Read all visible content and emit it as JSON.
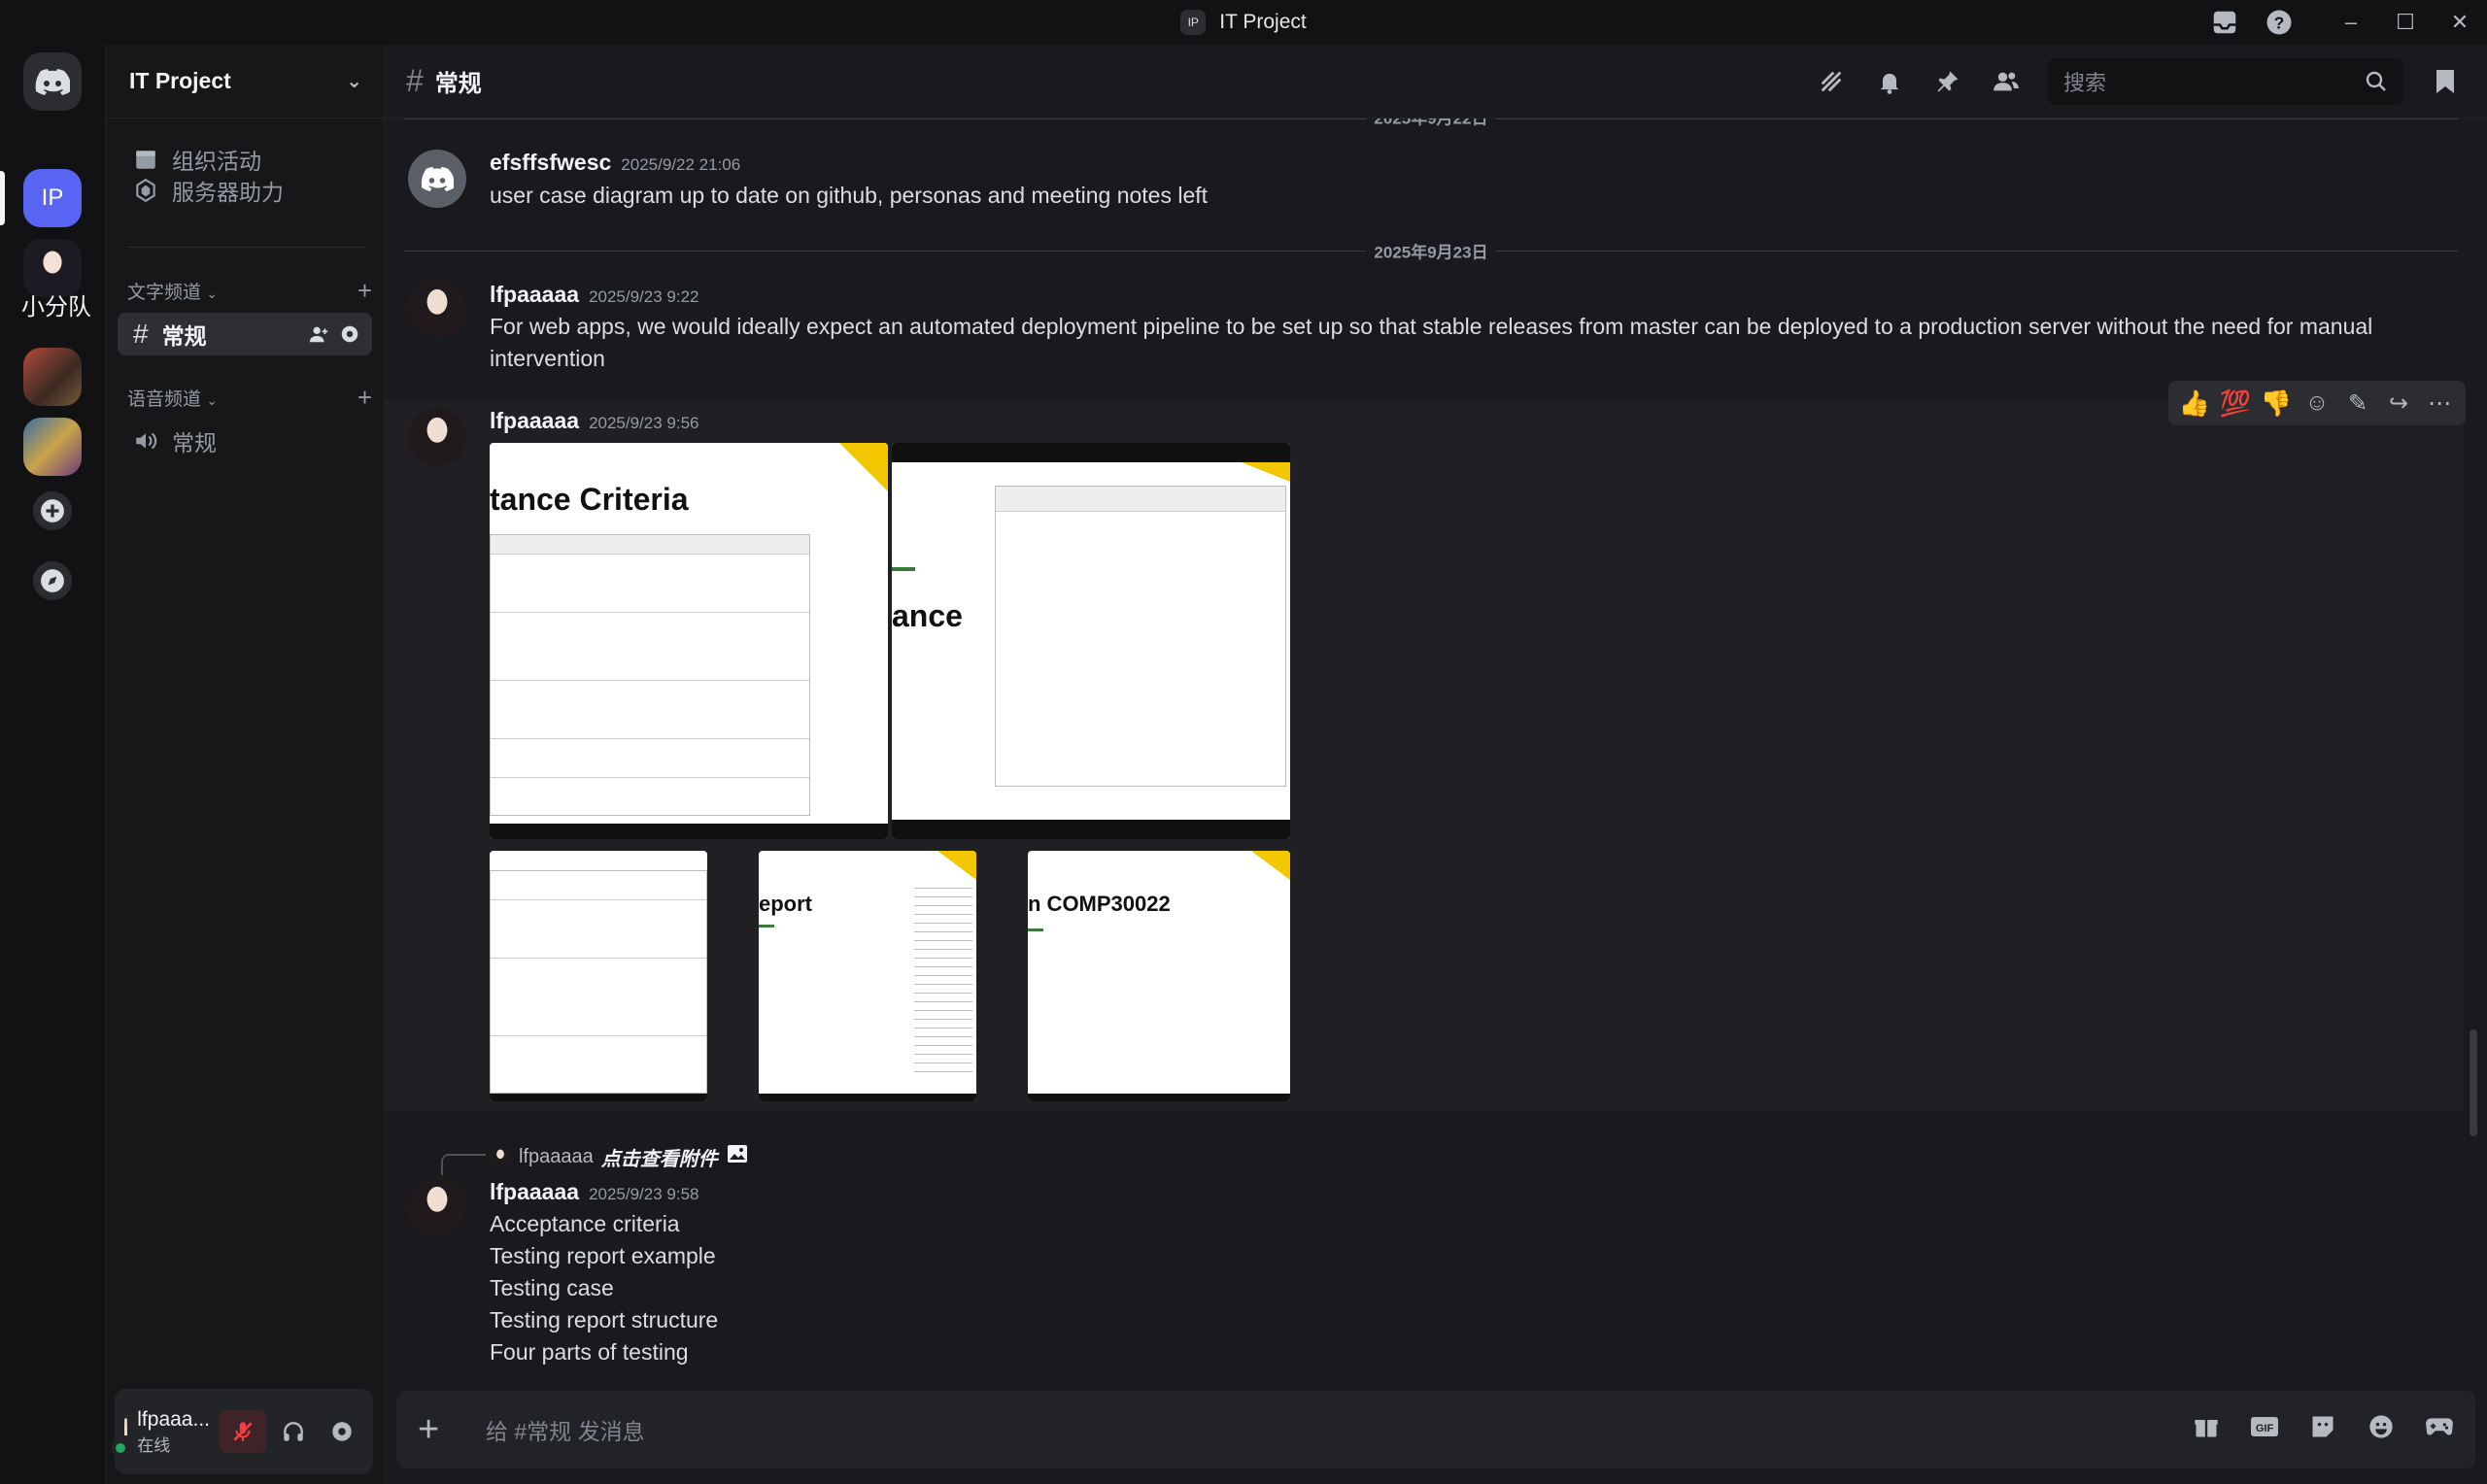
{
  "window": {
    "title": "IT Project",
    "badge": "IP"
  },
  "rail": {
    "active_server": "IP",
    "partial_label": "小分队"
  },
  "server": {
    "name": "IT Project",
    "events": "组织活动",
    "boosts": "服务器助力",
    "text_category": "文字频道",
    "text_channel": "常规",
    "voice_category": "语音频道",
    "voice_channel": "常规"
  },
  "user": {
    "name": "lfpaaa...",
    "status": "在线"
  },
  "channel": {
    "name": "常规",
    "search_placeholder": "搜索"
  },
  "messages": {
    "date_top": "2025年9月22日",
    "m1": {
      "author": "efsffsfwesc",
      "time": "2025/9/22 21:06",
      "text": "user case diagram up to date on github, personas and meeting notes left"
    },
    "date_2": "2025年9月23日",
    "m2": {
      "author": "lfpaaaaa",
      "time": "2025/9/23 9:22",
      "line1": "For web apps, we would ideally expect an automated deployment  pipeline to be set up so that stable releases from master can be deployed to a production server without the need for manual",
      "line2": "intervention"
    },
    "m3": {
      "author": "lfpaaaaa",
      "time": "2025/9/23 9:56",
      "img1_title": "tance Criteria",
      "img2_title": "ance",
      "img4_title": "eport",
      "img5_title": "n COMP30022"
    },
    "m4": {
      "reply_author": "lfpaaaaa",
      "reply_text": "点击查看附件",
      "author": "lfpaaaaa",
      "time": "2025/9/23 9:58",
      "lines": [
        "Acceptance criteria",
        "Testing report example",
        "Testing case",
        "Testing report structure",
        "Four parts of testing"
      ]
    }
  },
  "reactions": [
    "👍",
    "💯",
    "👎"
  ],
  "composer": {
    "placeholder": "给 #常规 发消息"
  }
}
